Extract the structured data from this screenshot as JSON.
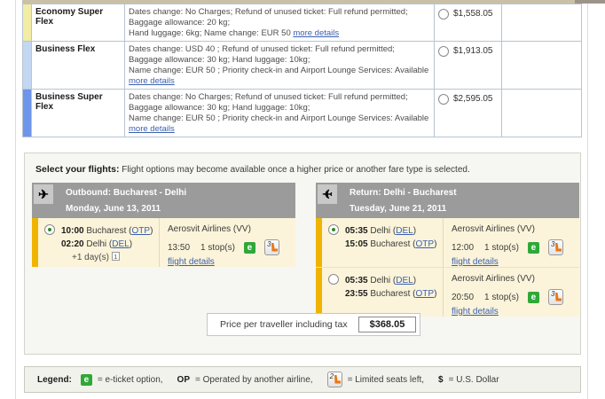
{
  "colors": {
    "economy_band": "#F2ECA4",
    "business_flex_band": "#C3D6F2",
    "business_super_flex_band": "#6D95E9",
    "flight_row_band": "#F0B400",
    "flight_row_bg": "#FBF4DA",
    "header_bar_gray": "#9B9B9B",
    "eticket_green": "#2FA838",
    "seat_icon_orange": "#E87818"
  },
  "fare_table": {
    "rows": [
      {
        "name": "Economy Super Flex",
        "description": "Dates change: No Charges; Refund of unused ticket: Full refund permitted; Baggage allowance: 20 kg;\nHand luggage: 6kg; Name change: EUR 50 ",
        "more_details": "more details",
        "price": "$1,558.05"
      },
      {
        "name": "Business Flex",
        "description": "Dates change: USD 40 ; Refund of unused ticket: Full refund permitted; Baggage allowance: 30 kg; Hand luggage: 10kg;\nName change: EUR 50 ; Priority check-in and Airport Lounge Services: Available\n",
        "more_details": "more details",
        "price": "$1,913.05"
      },
      {
        "name": "Business Super Flex",
        "description": "Dates change: No Charges; Refund of unused ticket: Full refund permitted; Baggage allowance: 30 kg; Hand luggage: 10kg;\nName change: EUR 50 ; Priority check-in and Airport Lounge Services: Available\n",
        "more_details": "more details",
        "price": "$2,595.05"
      }
    ]
  },
  "select_flights": {
    "title": "Select your flights:",
    "subtitle": "Flight options may become available once a higher price or another fare type is selected.",
    "panels": [
      {
        "header_route": "Outbound: Bucharest - Delhi",
        "header_date": "Monday, June 13, 2011",
        "plane_icon": "✈",
        "options": [
          {
            "dep_time": "10:00",
            "dep_city": "Bucharest",
            "dep_code": "OTP",
            "arr_time": "02:20",
            "arr_city": "Delhi",
            "arr_code": "DEL",
            "plus_days": "+1 day(s)",
            "plus_days_badge": "1",
            "airline": "Aerosvit Airlines (VV)",
            "duration": "13:50",
            "stops": "1 stop(s)",
            "eticket": "e",
            "seats_left": "3",
            "details_link": "flight details"
          }
        ]
      },
      {
        "header_route": "Return: Delhi - Bucharest",
        "header_date": "Tuesday, June 21, 2011",
        "plane_icon": "✈",
        "options": [
          {
            "dep_time": "05:35",
            "dep_city": "Delhi",
            "dep_code": "DEL",
            "arr_time": "15:05",
            "arr_city": "Bucharest",
            "arr_code": "OTP",
            "airline": "Aerosvit Airlines (VV)",
            "duration": "12:00",
            "stops": "1 stop(s)",
            "eticket": "e",
            "seats_left": "3",
            "details_link": "flight details"
          },
          {
            "dep_time": "05:35",
            "dep_city": "Delhi",
            "dep_code": "DEL",
            "arr_time": "23:55",
            "arr_city": "Bucharest",
            "arr_code": "OTP",
            "airline": "Aerosvit Airlines (VV)",
            "duration": "20:50",
            "stops": "1 stop(s)",
            "eticket": "e",
            "seats_left": "3",
            "details_link": "flight details"
          }
        ]
      }
    ],
    "price_label": "Price per traveller including tax",
    "price_value": "$368.05"
  },
  "legend": {
    "title": "Legend:",
    "eticket_icon": "e",
    "eticket_text": "= e-ticket option,",
    "op_label": "OP",
    "op_text": "= Operated by another airline,",
    "seat_badge_number": "2",
    "seats_text": "= Limited seats left,",
    "dollar_label": "$",
    "dollar_text": "= U.S. Dollar"
  }
}
